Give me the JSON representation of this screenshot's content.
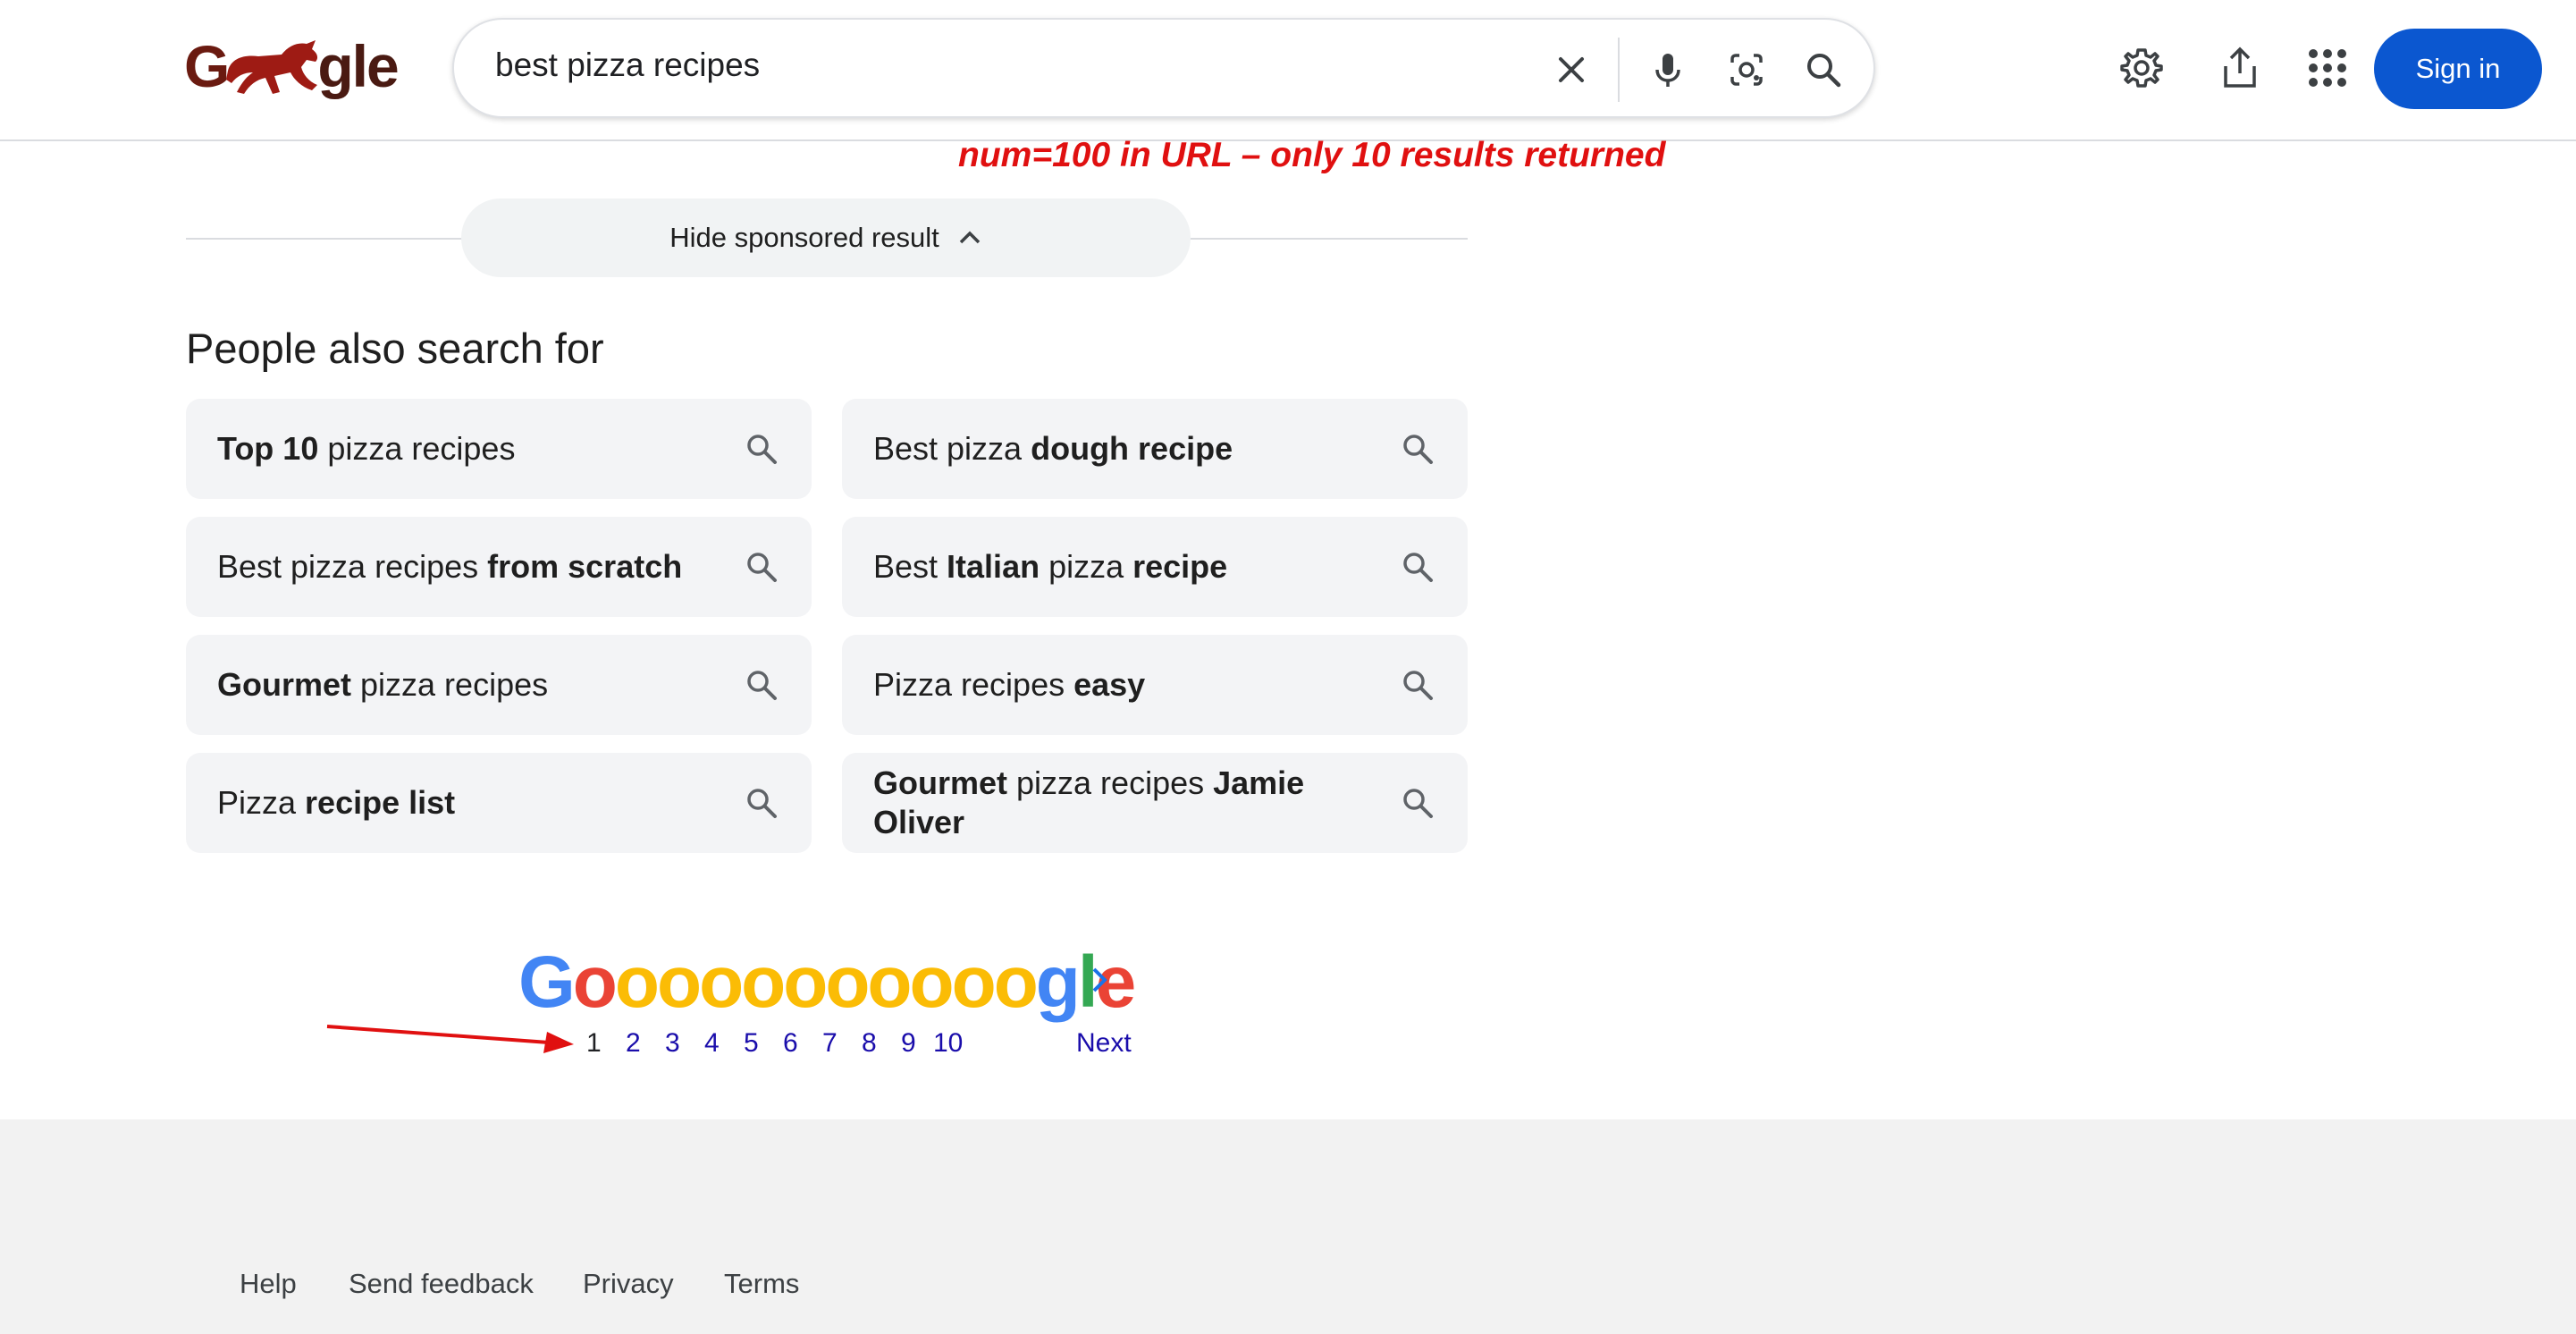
{
  "search": {
    "query": "best pizza recipes"
  },
  "header": {
    "sign_in": "Sign in"
  },
  "annotation": {
    "text": "num=100 in URL – only 10 results returned"
  },
  "sponsored": {
    "toggle_label": "Hide sponsored result"
  },
  "people_also_search": {
    "title": "People also search for",
    "items": [
      {
        "parts": [
          [
            "Top 10",
            true
          ],
          [
            " pizza recipes",
            false
          ]
        ]
      },
      {
        "parts": [
          [
            "Best pizza ",
            false
          ],
          [
            "dough recipe",
            true
          ]
        ]
      },
      {
        "parts": [
          [
            "Best pizza recipes ",
            false
          ],
          [
            "from scratch",
            true
          ]
        ]
      },
      {
        "parts": [
          [
            "Best ",
            false
          ],
          [
            "Italian",
            true
          ],
          [
            " pizza ",
            false
          ],
          [
            "recipe",
            true
          ]
        ]
      },
      {
        "parts": [
          [
            "Gourmet",
            true
          ],
          [
            " pizza recipes",
            false
          ]
        ]
      },
      {
        "parts": [
          [
            "Pizza recipes ",
            false
          ],
          [
            "easy",
            true
          ]
        ]
      },
      {
        "parts": [
          [
            "Pizza ",
            false
          ],
          [
            "recipe list",
            true
          ]
        ]
      },
      {
        "parts": [
          [
            "Gourmet",
            true
          ],
          [
            " pizza recipes ",
            false
          ],
          [
            "Jamie Oliver",
            true
          ]
        ]
      }
    ]
  },
  "pagination": {
    "pages": [
      "1",
      "2",
      "3",
      "4",
      "5",
      "6",
      "7",
      "8",
      "9",
      "10"
    ],
    "current": "1",
    "next_label": "Next"
  },
  "footer": {
    "links": [
      "Help",
      "Send feedback",
      "Privacy",
      "Terms"
    ]
  },
  "colors": {
    "accent": "#0b57d0",
    "link": "#1a0dab",
    "annotation": "#e01010"
  }
}
